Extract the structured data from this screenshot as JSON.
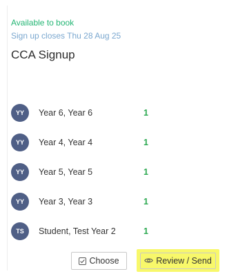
{
  "card": {
    "status": "Available to book",
    "closes": "Sign up closes Thu 28 Aug 25",
    "title": "CCA Signup"
  },
  "students": [
    {
      "initials": "YY",
      "name": "Year 6, Year 6",
      "count": "1"
    },
    {
      "initials": "YY",
      "name": "Year 4, Year 4",
      "count": "1"
    },
    {
      "initials": "YY",
      "name": "Year 5, Year 5",
      "count": "1"
    },
    {
      "initials": "YY",
      "name": "Year 3, Year 3",
      "count": "1"
    },
    {
      "initials": "TS",
      "name": "Student, Test Year 2",
      "count": "1"
    }
  ],
  "actions": {
    "choose_label": "Choose",
    "review_label": "Review / Send"
  },
  "icons": {
    "choose": "checkbox-icon",
    "review": "eye-icon"
  },
  "colors": {
    "status": "#22b573",
    "closes": "#7aa7cf",
    "avatar": "#4f5f86",
    "count": "#2aa84f",
    "highlight": "#f8f86a"
  }
}
